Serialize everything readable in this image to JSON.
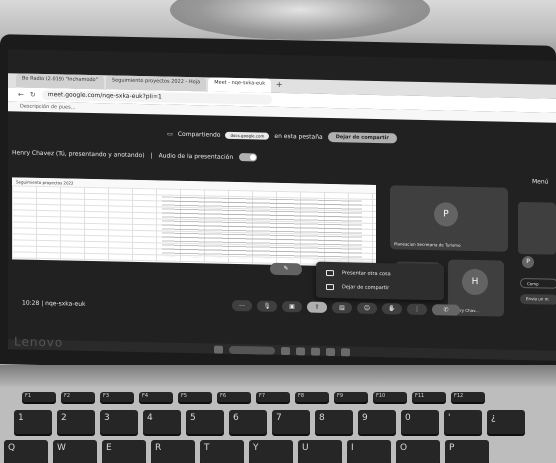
{
  "browser": {
    "tabs": [
      {
        "label": "Bo Radio (2.019) \"Inchamodo\"",
        "active": false
      },
      {
        "label": "Seguimiento proyectos 2022 - Hoja",
        "active": false
      },
      {
        "label": "Meet - nqe-sxka-euk",
        "active": true
      }
    ],
    "new_tab": "+",
    "url": "meet.google.com/nqe-sxka-euk?pli=1",
    "bookmark": "Descripción de pues..."
  },
  "meet": {
    "banner_label": "Compartiendo",
    "banner_source": "docs.google.com",
    "banner_suffix": "en esta pestaña",
    "stop_share": "Dejar de compartir",
    "presenting": "Henry Chavez (Tú, presentando y anotando)",
    "audio": "Audio de la presentación",
    "side_title": "Menú",
    "sheet_title": "Seguimiento proyectos 2022",
    "participants": [
      {
        "initial": "P",
        "name": "Planeacion Secretaria de Turismo"
      },
      {
        "initial": "H",
        "name": "Henry Chav..."
      }
    ],
    "side_avatar": "P",
    "side_buttons": [
      "Comp",
      "Envía un m"
    ],
    "present_menu": [
      "Presentar otra cosa",
      "Dejar de compartir"
    ],
    "time": "10:28",
    "meeting_code": "nqe-sxka-euk"
  },
  "laptop": {
    "brand": "Lenovo"
  },
  "keyboard": {
    "fn_row": [
      "F1",
      "F2",
      "F3",
      "F4",
      "F5",
      "F6",
      "F7",
      "F8",
      "F9",
      "F10",
      "F11",
      "F12"
    ],
    "number_row": [
      "1",
      "2",
      "3",
      "4",
      "5",
      "6",
      "7",
      "8",
      "9",
      "0",
      "'",
      "¿"
    ],
    "letter_row": [
      "Q",
      "W",
      "E",
      "R",
      "T",
      "Y",
      "U",
      "I",
      "O",
      "P"
    ]
  },
  "colors": {
    "meet_bg": "#202124",
    "accent": "#8ab4f8",
    "end_call": "#ea4335"
  }
}
